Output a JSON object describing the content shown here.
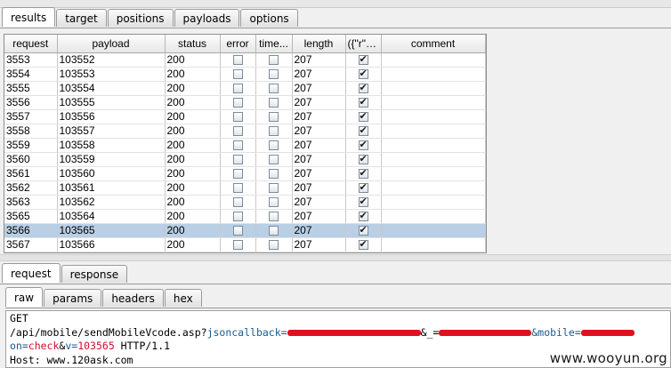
{
  "main_tabs": [
    {
      "label": "results",
      "active": true
    },
    {
      "label": "target",
      "active": false
    },
    {
      "label": "positions",
      "active": false
    },
    {
      "label": "payloads",
      "active": false
    },
    {
      "label": "options",
      "active": false
    }
  ],
  "table": {
    "columns": [
      "request",
      "payload",
      "status",
      "error",
      "time...",
      "length",
      "({\"r\":0})",
      "comment"
    ],
    "rows": [
      {
        "request": "3553",
        "payload": "103552",
        "status": "200",
        "length": "207",
        "selected": false
      },
      {
        "request": "3554",
        "payload": "103553",
        "status": "200",
        "length": "207",
        "selected": false
      },
      {
        "request": "3555",
        "payload": "103554",
        "status": "200",
        "length": "207",
        "selected": false
      },
      {
        "request": "3556",
        "payload": "103555",
        "status": "200",
        "length": "207",
        "selected": false
      },
      {
        "request": "3557",
        "payload": "103556",
        "status": "200",
        "length": "207",
        "selected": false
      },
      {
        "request": "3558",
        "payload": "103557",
        "status": "200",
        "length": "207",
        "selected": false
      },
      {
        "request": "3559",
        "payload": "103558",
        "status": "200",
        "length": "207",
        "selected": false
      },
      {
        "request": "3560",
        "payload": "103559",
        "status": "200",
        "length": "207",
        "selected": false
      },
      {
        "request": "3561",
        "payload": "103560",
        "status": "200",
        "length": "207",
        "selected": false
      },
      {
        "request": "3562",
        "payload": "103561",
        "status": "200",
        "length": "207",
        "selected": false
      },
      {
        "request": "3563",
        "payload": "103562",
        "status": "200",
        "length": "207",
        "selected": false
      },
      {
        "request": "3565",
        "payload": "103564",
        "status": "200",
        "length": "207",
        "selected": false
      },
      {
        "request": "3566",
        "payload": "103565",
        "status": "200",
        "length": "207",
        "selected": true
      },
      {
        "request": "3567",
        "payload": "103566",
        "status": "200",
        "length": "207",
        "selected": false
      }
    ]
  },
  "req_tabs": [
    {
      "label": "request",
      "active": true
    },
    {
      "label": "response",
      "active": false
    }
  ],
  "raw_tabs": [
    {
      "label": "raw",
      "active": true
    },
    {
      "label": "params",
      "active": false
    },
    {
      "label": "headers",
      "active": false
    },
    {
      "label": "hex",
      "active": false
    }
  ],
  "request_text": {
    "line1": "GET",
    "line2_path": "/api/mobile/sendMobileVcode.asp?",
    "line2_param1": "jsoncallback=",
    "line2_sep1": "&_=",
    "line2_param2": "&mobile=",
    "line3_key1": "on=",
    "line3_val1": "check",
    "line3_amp": "&",
    "line3_key2": "v=",
    "line3_val2": "103565",
    "line3_proto": " HTTP/1.1",
    "line4": "Host: www.120ask.com"
  },
  "watermark": "www.wooyun.org",
  "colors": {
    "selected_row": "#b8cfe5",
    "redaction": "#e0101d",
    "param_key": "#1b5a8c",
    "param_value": "#c8102e"
  }
}
